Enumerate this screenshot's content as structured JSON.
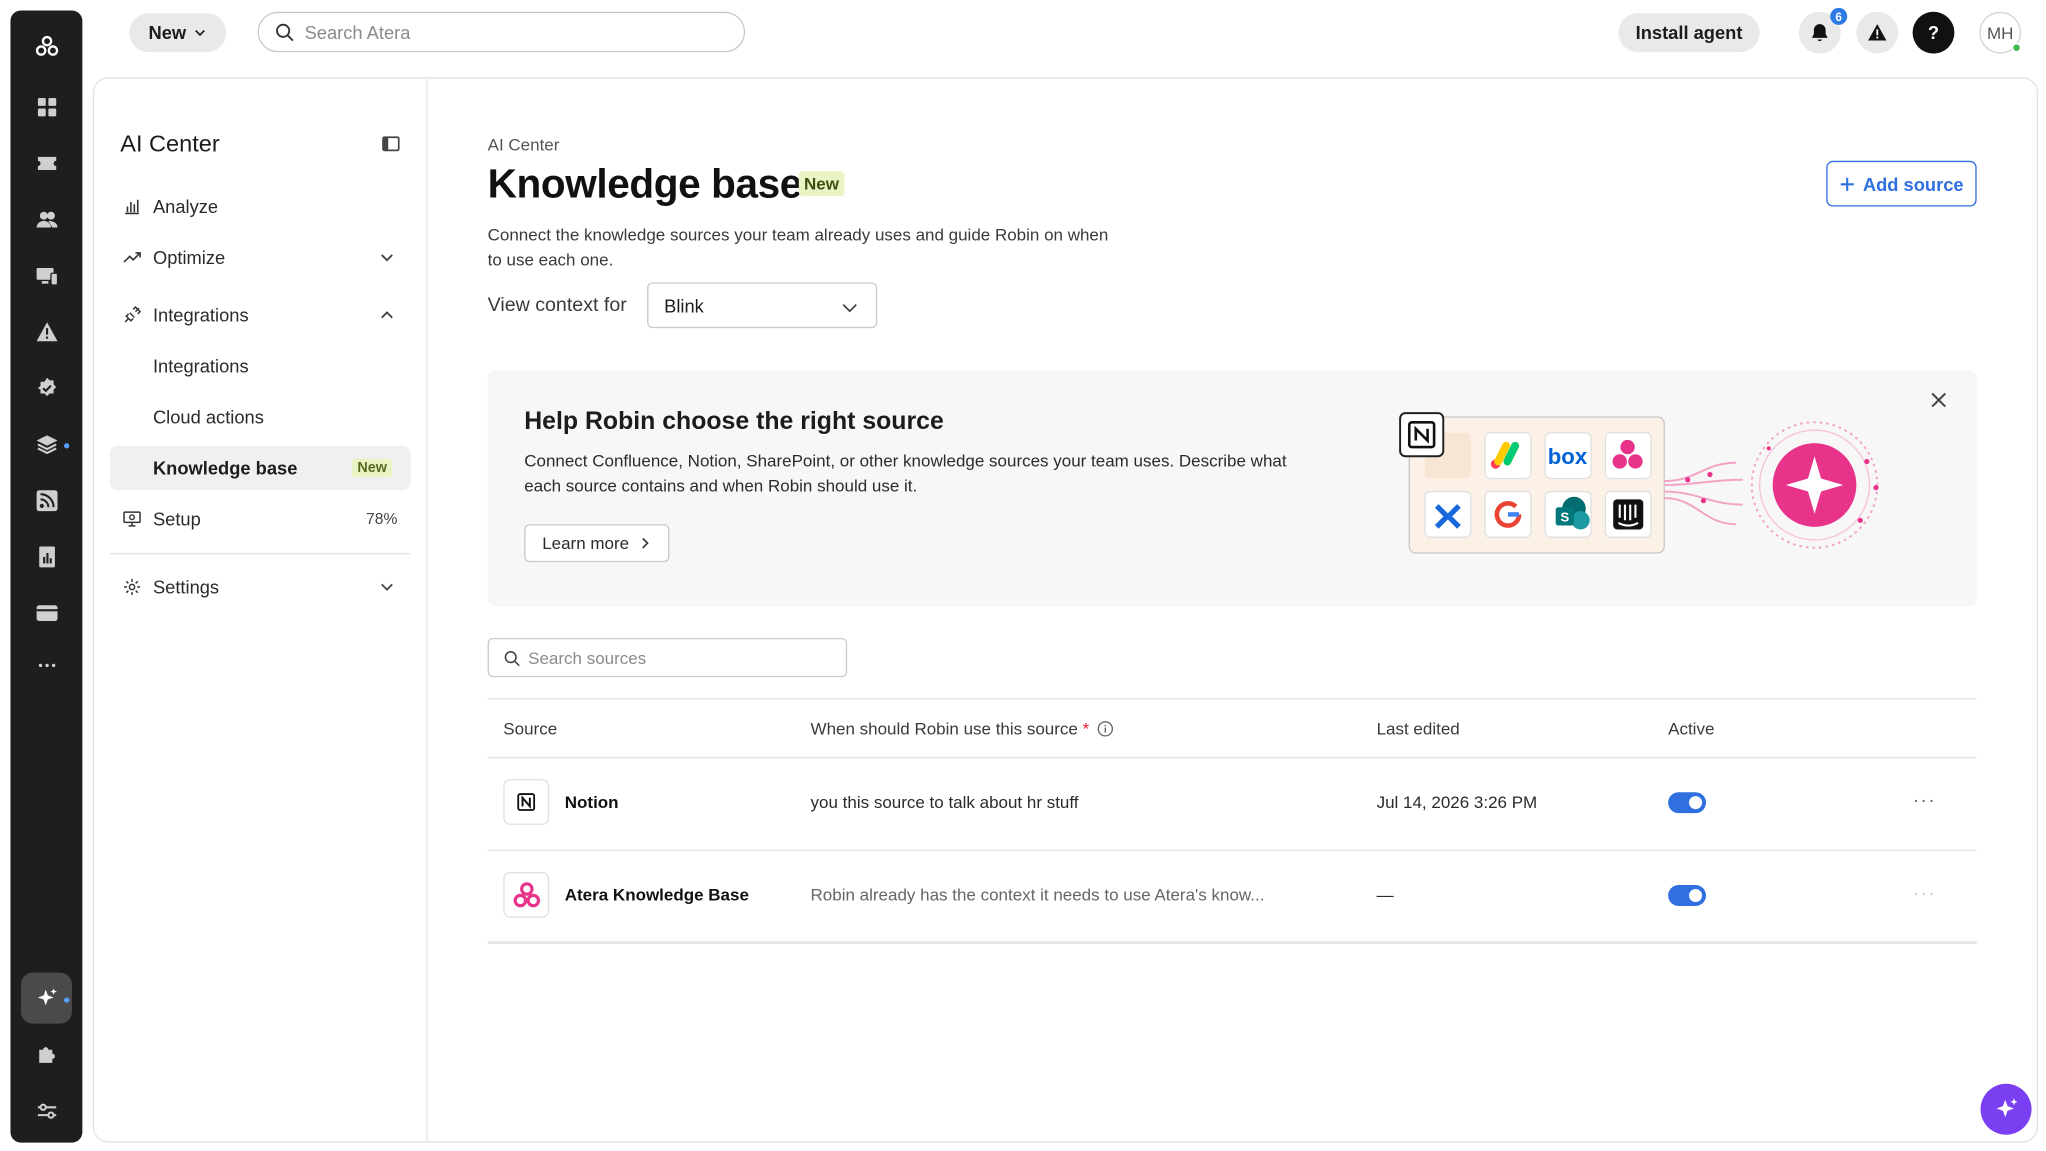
{
  "topbar": {
    "new_label": "New",
    "search_placeholder": "Search Atera",
    "install_label": "Install agent",
    "notification_count": "6",
    "user_initials": "MH"
  },
  "sidebar": {
    "title": "AI Center",
    "items": [
      {
        "label": "Analyze"
      },
      {
        "label": "Optimize"
      },
      {
        "label": "Integrations"
      },
      {
        "label": "Integrations"
      },
      {
        "label": "Cloud actions"
      },
      {
        "label": "Knowledge base",
        "tag": "New"
      },
      {
        "label": "Setup",
        "value": "78%"
      },
      {
        "label": "Settings"
      }
    ]
  },
  "page": {
    "breadcrumb": "AI Center",
    "title": "Knowledge base",
    "title_tag": "New",
    "description": "Connect the knowledge sources your team already uses and guide Robin on when to use each one.",
    "context_label": "View context for",
    "context_value": "Blink",
    "add_source_label": "Add source"
  },
  "banner": {
    "title": "Help Robin choose the right source",
    "text": "Connect Confluence, Notion, SharePoint, or other knowledge sources your team uses. Describe what each source contains and when Robin should use it.",
    "learn_more_label": "Learn more",
    "illustration_box_text": "box"
  },
  "sources": {
    "search_placeholder": "Search sources",
    "columns": {
      "source": "Source",
      "when": "When should Robin use this source",
      "required_mark": "*",
      "last_edited": "Last edited",
      "active": "Active"
    },
    "rows": [
      {
        "name": "Notion",
        "when": "you this source to talk about hr stuff",
        "last_edited": "Jul 14, 2026 3:26 PM",
        "active": true
      },
      {
        "name": "Atera Knowledge Base",
        "when": "Robin already has the context it needs to use Atera's know...",
        "last_edited": "—",
        "active": true
      }
    ]
  },
  "colors": {
    "accent": "#2f6fe0",
    "rail": "#1e1e1e",
    "new_tag_bg": "#eaf3c4",
    "robin_pink": "#e8338a",
    "robin_fab": "#7a3ff0"
  }
}
